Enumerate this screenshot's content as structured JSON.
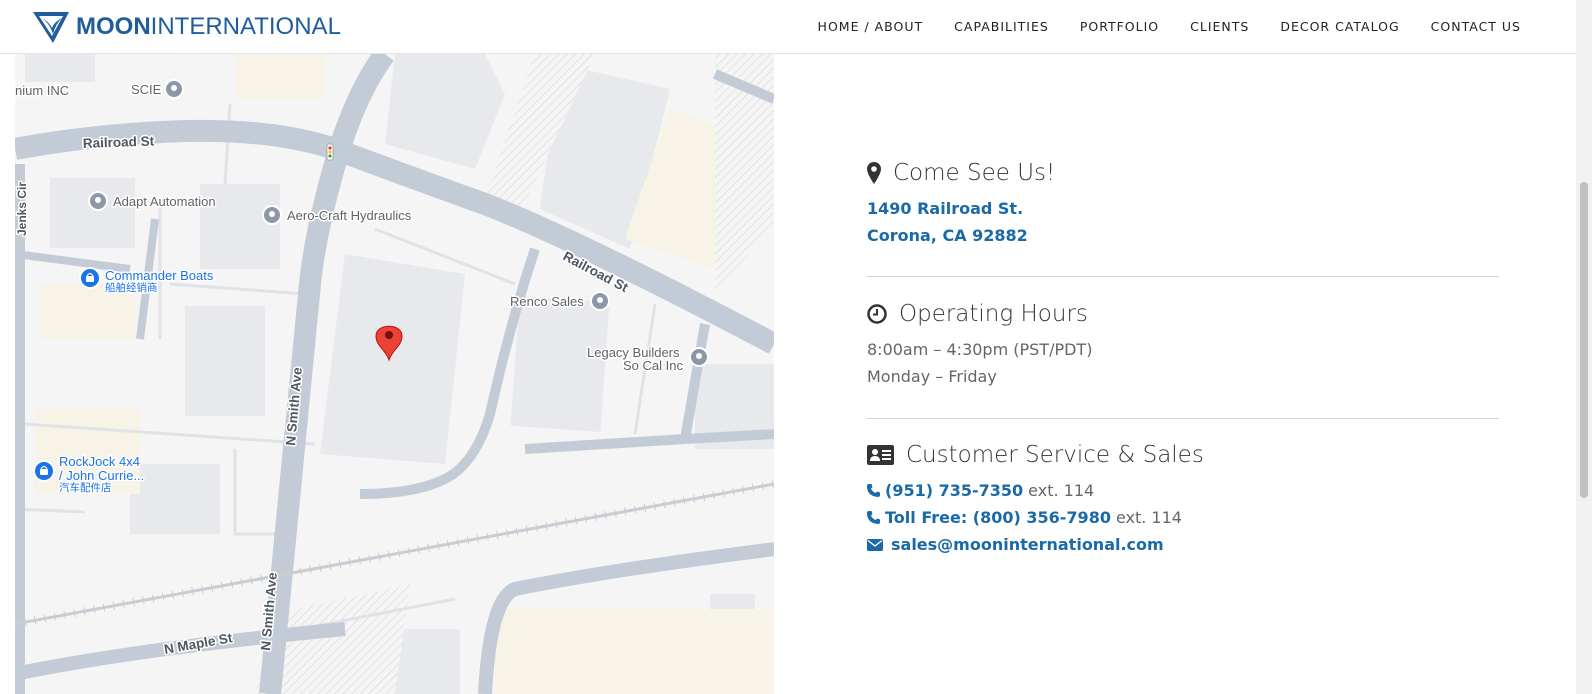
{
  "header": {
    "logo_bold": "MOON",
    "logo_light": "INTERNATIONAL",
    "nav": [
      {
        "label": "HOME / ABOUT"
      },
      {
        "label": "CAPABILITIES"
      },
      {
        "label": "PORTFOLIO"
      },
      {
        "label": "CLIENTS"
      },
      {
        "label": "DECOR CATALOG"
      },
      {
        "label": "CONTACT US"
      }
    ]
  },
  "map": {
    "labels": {
      "nium": "nium INC",
      "scie": "SCIE",
      "railroad1": "Railroad St",
      "railroad2": "Railroad St",
      "jenks": "Jenks Cir",
      "adapt": "Adapt Automation",
      "aerocraft": "Aero-Craft Hydraulics",
      "commander": "Commander Boats",
      "commander_cn": "船舶经销商",
      "renco": "Renco Sales",
      "legacy1": "Legacy Builders",
      "legacy2": "So Cal Inc",
      "smith1": "N Smith Ave",
      "smith2": "N Smith Ave",
      "rockjock1": "RockJock 4x4",
      "rockjock2": "/ John Currie...",
      "rockjock_cn": "汽车配件店",
      "maple": "N Maple St"
    },
    "colors": {
      "road": "#c3ccd6",
      "building": "#e8e9ed",
      "park": "#f7f3e6",
      "pin": "#ea4335",
      "poi_blue": "#1a73e8",
      "poi_grey": "#8a98a8"
    }
  },
  "contact": {
    "visit": {
      "icon": "map-marker-icon",
      "title": "Come See Us!",
      "address1": "1490 Railroad St.",
      "address2": "Corona, CA 92882"
    },
    "hours": {
      "icon": "clock-icon",
      "title": "Operating Hours",
      "time": "8:00am – 4:30pm (PST/PDT)",
      "days": "Monday – Friday"
    },
    "service": {
      "icon": "id-card-icon",
      "title": "Customer Service & Sales",
      "phone": "(951) 735-7350",
      "phone_ext": "ext. 114",
      "tollfree": "Toll Free: (800) 356-7980",
      "tollfree_ext": "ext. 114",
      "email": "sales@mooninternational.com"
    }
  },
  "theme": {
    "link": "#1a6aa8",
    "logo": "#1f5d9c"
  }
}
